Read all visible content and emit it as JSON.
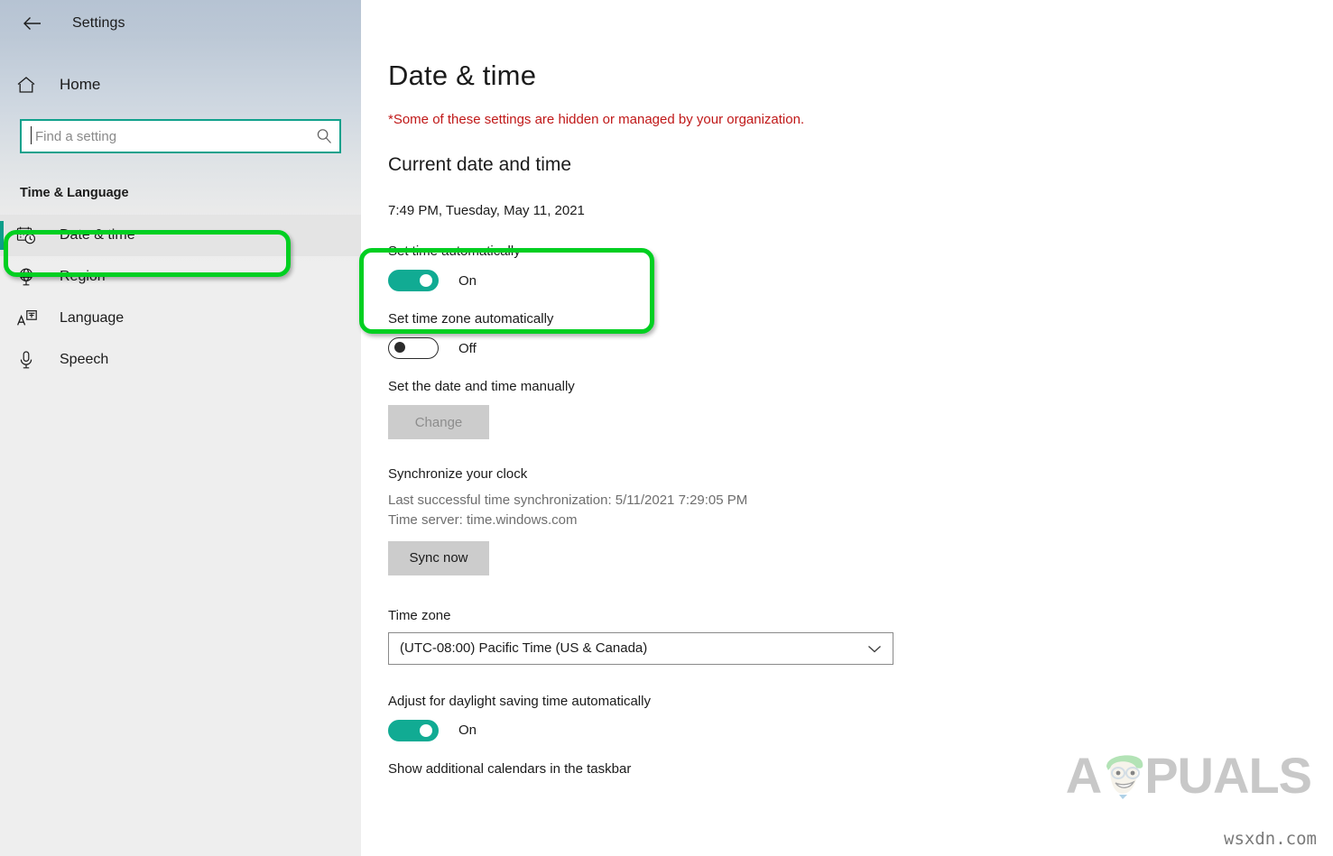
{
  "window": {
    "app_title": "Settings",
    "back_icon": "back-arrow-icon"
  },
  "sidebar": {
    "home": {
      "label": "Home",
      "icon": "home-icon"
    },
    "search": {
      "placeholder": "Find a setting",
      "value": "",
      "icon": "search-icon"
    },
    "group_title": "Time & Language",
    "items": [
      {
        "label": "Date & time",
        "icon": "calendar-clock-icon",
        "selected": true
      },
      {
        "label": "Region",
        "icon": "globe-icon",
        "selected": false
      },
      {
        "label": "Language",
        "icon": "language-icon",
        "selected": false
      },
      {
        "label": "Speech",
        "icon": "microphone-icon",
        "selected": false
      }
    ]
  },
  "main": {
    "page_title": "Date & time",
    "org_note": "*Some of these settings are hidden or managed by your organization.",
    "current_section_title": "Current date and time",
    "current_datetime": "7:49 PM, Tuesday, May 11, 2021",
    "set_time_auto": {
      "label": "Set time automatically",
      "state": "On",
      "on": true
    },
    "set_timezone_auto": {
      "label": "Set time zone automatically",
      "state": "Off",
      "on": false
    },
    "manual": {
      "label": "Set the date and time manually",
      "button": "Change",
      "disabled": true
    },
    "sync": {
      "title": "Synchronize your clock",
      "last_sync": "Last successful time synchronization: 5/11/2021 7:29:05 PM",
      "server": "Time server: time.windows.com",
      "button": "Sync now"
    },
    "timezone": {
      "label": "Time zone",
      "value": "(UTC-08:00) Pacific Time (US & Canada)",
      "chevron": "chevron-down-icon"
    },
    "dst": {
      "label": "Adjust for daylight saving time automatically",
      "state": "On",
      "on": true
    },
    "additional_calendars": {
      "label": "Show additional calendars in the taskbar"
    }
  },
  "annotations": [
    {
      "name": "highlight-date-time-nav",
      "color": "#00cf21"
    },
    {
      "name": "highlight-set-time-automatically",
      "color": "#00cf21"
    }
  ],
  "watermark": {
    "brand": "APPUALS",
    "brand_part_1": "A",
    "brand_part_2": "PUALS",
    "site": "wsxdn.com"
  }
}
